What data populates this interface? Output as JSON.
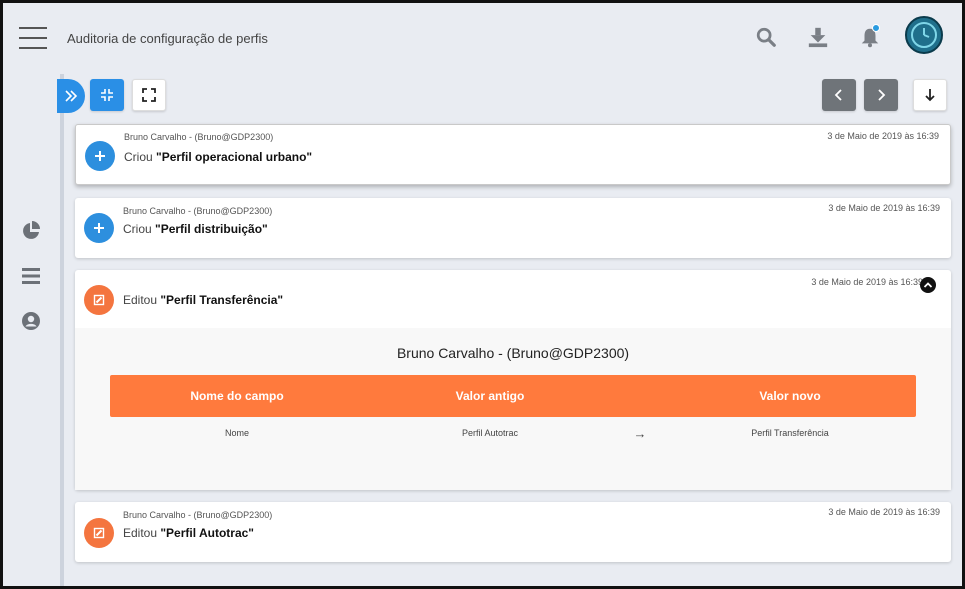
{
  "header": {
    "title": "Auditoria de configuração de perfis",
    "icons": [
      "menu-icon",
      "search-icon",
      "download-icon",
      "bell-icon",
      "avatar"
    ]
  },
  "colors": {
    "accent": "#2a8fe6",
    "orange": "#ff7a3d",
    "edit_badge": "#f4753f",
    "gray_button": "#6f7479",
    "background": "#e9ecf2"
  },
  "sidebar": {
    "icons": [
      "pie-chart-icon",
      "list-icon",
      "user-circle-icon"
    ]
  },
  "entries": [
    {
      "author": "Bruno Carvalho - (Bruno@GDP2300)",
      "verb": "Criou ",
      "target": "\"Perfil operacional urbano\"",
      "date": "3 de Maio de 2019 às 16:39",
      "type": "create"
    },
    {
      "author": "Bruno Carvalho - (Bruno@GDP2300)",
      "verb": "Criou ",
      "target": "\"Perfil distribuição\"",
      "date": "3 de Maio de 2019 às 16:39",
      "type": "create"
    },
    {
      "verb": "Editou ",
      "target": "\"Perfil Transferência\"",
      "date": "3 de Maio de 2019 às 16:39",
      "type": "edit",
      "expanded": true,
      "detail_user": "Bruno Carvalho - (Bruno@GDP2300)",
      "columns": [
        "Nome do campo",
        "Valor antigo",
        "Valor novo"
      ],
      "rows": [
        {
          "field": "Nome",
          "old": "Perfil Autotrac",
          "arrow": "→",
          "new": "Perfil Transferência"
        }
      ]
    },
    {
      "author": "Bruno Carvalho - (Bruno@GDP2300)",
      "verb": "Editou ",
      "target": "\"Perfil Autotrac\"",
      "date": "3 de Maio de 2019 às 16:39",
      "type": "edit"
    }
  ]
}
